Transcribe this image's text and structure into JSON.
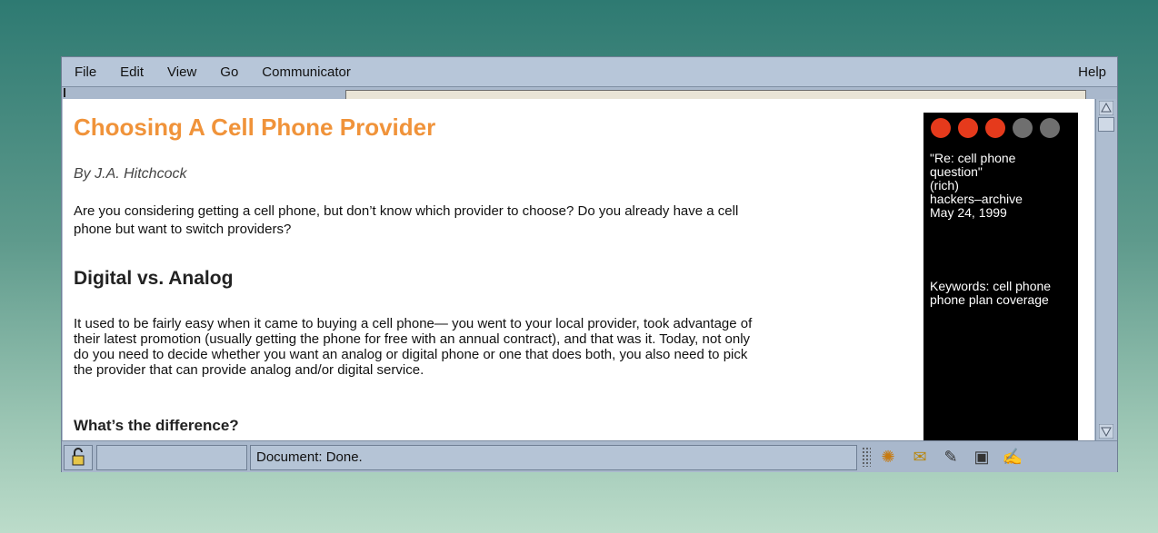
{
  "menu": {
    "file": "File",
    "edit": "Edit",
    "view": "View",
    "go": "Go",
    "communicator": "Communicator",
    "help": "Help"
  },
  "article": {
    "title": "Choosing A Cell Phone Provider",
    "byline": "By J.A. Hitchcock",
    "intro": "Are you considering getting a cell phone, but don’t know which provider to choose? Do you already have a cell phone but want to switch providers?",
    "section_heading": "Digital vs. Analog",
    "section_body": "It used to be fairly easy when it came to buying a cell phone— you went to your local provider, took advantage of their latest promotion (usually getting the phone for free with an annual contract), and that was it. Today, not only do you need to decide whether you want an analog or digital phone or one that does both, you also need to pick the provider that can provide analog and/or digital service.",
    "subheading": "What’s the difference?"
  },
  "sidepanel": {
    "rating": 3,
    "rating_max": 5,
    "rating_colors": {
      "filled": "#e53a1c",
      "empty": "#6f6f6f"
    },
    "source_lines": [
      "\"Re: cell phone",
      "question\"",
      "(rich)",
      "hackers–archive",
      "May 24, 1999"
    ],
    "keywords": "Keywords: cell phone phone plan coverage"
  },
  "statusbar": {
    "status_text": "Document: Done.",
    "icons": [
      "lock-icon",
      "navigator-icon",
      "mail-icon",
      "discussion-icon",
      "address-book-icon",
      "composer-icon"
    ]
  },
  "colors": {
    "title": "#f0933a",
    "chrome": "#aebdd0"
  }
}
